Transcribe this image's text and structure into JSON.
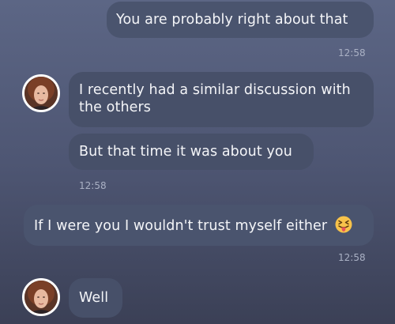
{
  "messages": [
    {
      "id": "m1",
      "direction": "outgoing",
      "text": "You are probably right about that",
      "time": "12:58"
    },
    {
      "id": "m2",
      "direction": "incoming",
      "text": "I recently had a similar discussion with the others"
    },
    {
      "id": "m3",
      "direction": "incoming",
      "text": "But that time it was about you",
      "time": "12:58"
    },
    {
      "id": "m4",
      "direction": "outgoing",
      "text": "If I were you I wouldn't trust myself either",
      "emoji": "squinting-face-with-tongue",
      "time": "12:58"
    },
    {
      "id": "m5",
      "direction": "incoming",
      "text": "Well"
    }
  ],
  "colors": {
    "background_top": "#5c6685",
    "background_bottom": "#3b4056",
    "bubble": "#475069",
    "timestamp": "#aab1c4",
    "avatar_border": "#ffffff"
  },
  "icons": {
    "avatar": "contact-avatar",
    "emoji": "squinting-face-with-tongue-emoji"
  }
}
